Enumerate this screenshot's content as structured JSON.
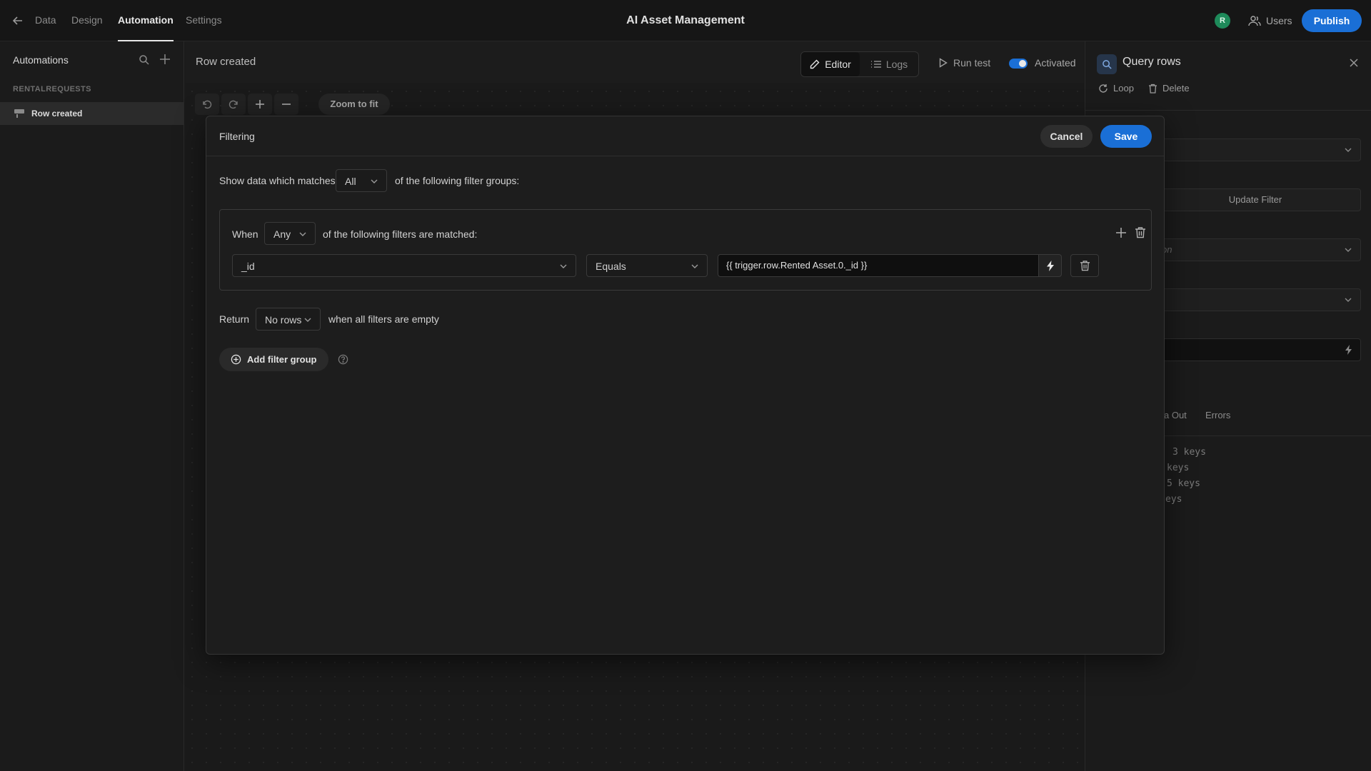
{
  "topbar": {
    "tabs": [
      {
        "label": "Data"
      },
      {
        "label": "Design"
      },
      {
        "label": "Automation"
      },
      {
        "label": "Settings"
      }
    ],
    "app_title": "AI Asset Management",
    "avatar_initial": "R",
    "users_label": "Users",
    "publish_label": "Publish"
  },
  "sidebar": {
    "title": "Automations",
    "group_label": "RENTALREQUESTS",
    "items": [
      {
        "label": "Row created"
      }
    ]
  },
  "canvas": {
    "title": "Row created",
    "editor_label": "Editor",
    "logs_label": "Logs",
    "run_test_label": "Run test",
    "activated_label": "Activated",
    "zoom_fit_label": "Zoom to fit"
  },
  "right_panel": {
    "title": "Query rows",
    "loop_label": "Loop",
    "delete_label": "Delete",
    "update_filter_label": "Update Filter",
    "partial_placeholder": "on",
    "tabs": [
      "a Out",
      "Errors"
    ],
    "keys": [
      "3 keys",
      "keys",
      "5 keys",
      "eys"
    ]
  },
  "modal": {
    "title": "Filtering",
    "cancel_label": "Cancel",
    "save_label": "Save",
    "show_prefix": "Show data which matches",
    "match_value": "All",
    "show_suffix": "of the following filter groups:",
    "group": {
      "when_label": "When",
      "match_value": "Any",
      "suffix": "of the following filters are matched:",
      "filter": {
        "field": "_id",
        "operator": "Equals",
        "value": "{{ trigger.row.Rented Asset.0._id }}"
      }
    },
    "return_label": "Return",
    "return_value": "No rows",
    "return_suffix": "when all filters are empty",
    "add_group_label": "Add filter group"
  },
  "colors": {
    "accent": "#1a6fd6",
    "background": "#1a1a1a",
    "avatar": "#1e8a5a"
  },
  "icons": [
    "back-arrow-icon",
    "users-icon",
    "search-icon",
    "plus-icon",
    "row-icon",
    "pencil-icon",
    "list-icon",
    "play-icon",
    "undo-icon",
    "redo-icon",
    "minus-icon",
    "close-icon",
    "loop-icon",
    "trash-icon",
    "chevron-down-icon",
    "bolt-icon",
    "plus-circle-icon",
    "help-icon"
  ]
}
